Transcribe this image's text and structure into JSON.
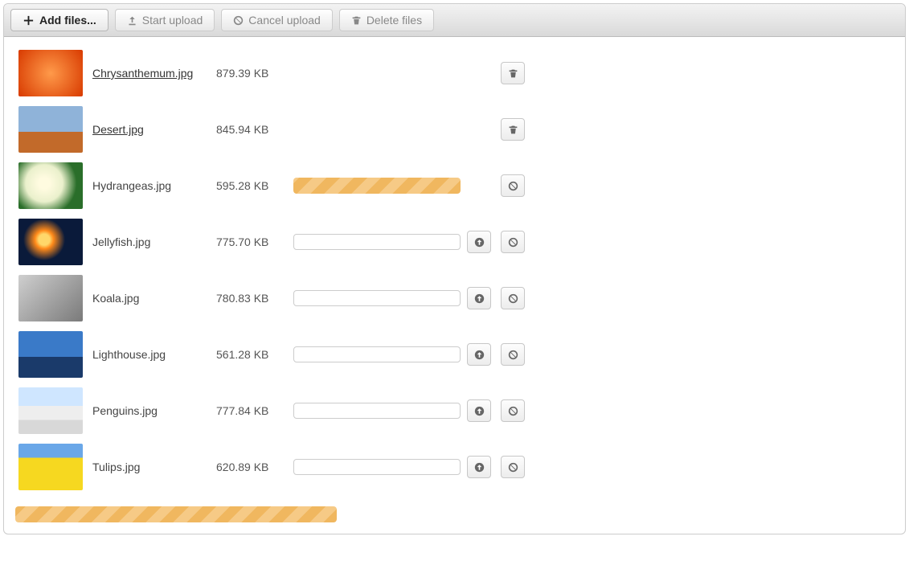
{
  "toolbar": {
    "add_label": "Add files...",
    "start_label": "Start upload",
    "cancel_label": "Cancel upload",
    "delete_label": "Delete files"
  },
  "files": [
    {
      "name": "Chrysanthemum.jpg",
      "size": "879.39 KB",
      "state": "done"
    },
    {
      "name": "Desert.jpg",
      "size": "845.94 KB",
      "state": "done"
    },
    {
      "name": "Hydrangeas.jpg",
      "size": "595.28 KB",
      "state": "uploading"
    },
    {
      "name": "Jellyfish.jpg",
      "size": "775.70 KB",
      "state": "queued"
    },
    {
      "name": "Koala.jpg",
      "size": "780.83 KB",
      "state": "queued"
    },
    {
      "name": "Lighthouse.jpg",
      "size": "561.28 KB",
      "state": "queued"
    },
    {
      "name": "Penguins.jpg",
      "size": "777.84 KB",
      "state": "queued"
    },
    {
      "name": "Tulips.jpg",
      "size": "620.89 KB",
      "state": "queued"
    }
  ]
}
